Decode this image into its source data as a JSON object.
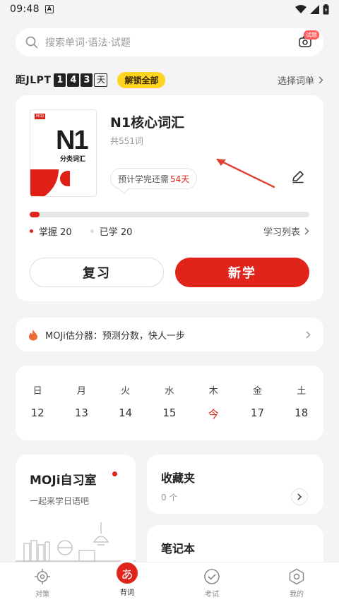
{
  "status_bar": {
    "time": "09:48",
    "notification_icon": "A"
  },
  "search": {
    "placeholder": "搜索单词·语法·试题",
    "badge": "试题"
  },
  "jlpt": {
    "prefix": "距JLPT",
    "digits": [
      "1",
      "4",
      "3"
    ],
    "suffix": "天",
    "unlock_label": "解锁全部",
    "choose_label": "选择词单"
  },
  "book": {
    "cover_brand": "MOJi",
    "cover_title": "N1",
    "cover_subtitle": "分类词汇",
    "title": "N1核心词汇",
    "count": "共551词",
    "eta_prefix": "预计学完还需",
    "eta_days": "54天",
    "progress_fraction": 0.036,
    "mastered": "掌握 20",
    "learned": "已学 20",
    "list_label": "学习列表",
    "review_label": "复习",
    "new_label": "新学"
  },
  "estimator": {
    "text": "MOJi估分器：预测分数，快人一步"
  },
  "calendar": {
    "weekdays": [
      "日",
      "月",
      "火",
      "水",
      "木",
      "金",
      "土"
    ],
    "dates": [
      "12",
      "13",
      "14",
      "15",
      "今",
      "17",
      "18"
    ]
  },
  "study_room": {
    "title": "MOJi自习室",
    "subtitle": "一起来学日语吧"
  },
  "favorites": {
    "title": "收藏夹",
    "count": "0 个"
  },
  "notebook": {
    "title": "笔记本"
  },
  "tabs": [
    {
      "label": "对策",
      "icon": "target-icon"
    },
    {
      "label": "背词",
      "icon": "kana-icon",
      "glyph": "あ"
    },
    {
      "label": "考试",
      "icon": "check-circle-icon"
    },
    {
      "label": "我的",
      "icon": "profile-icon"
    }
  ],
  "colors": {
    "accent": "#e0231b",
    "unlock": "#ffd51f",
    "background": "#f4f4f6"
  }
}
